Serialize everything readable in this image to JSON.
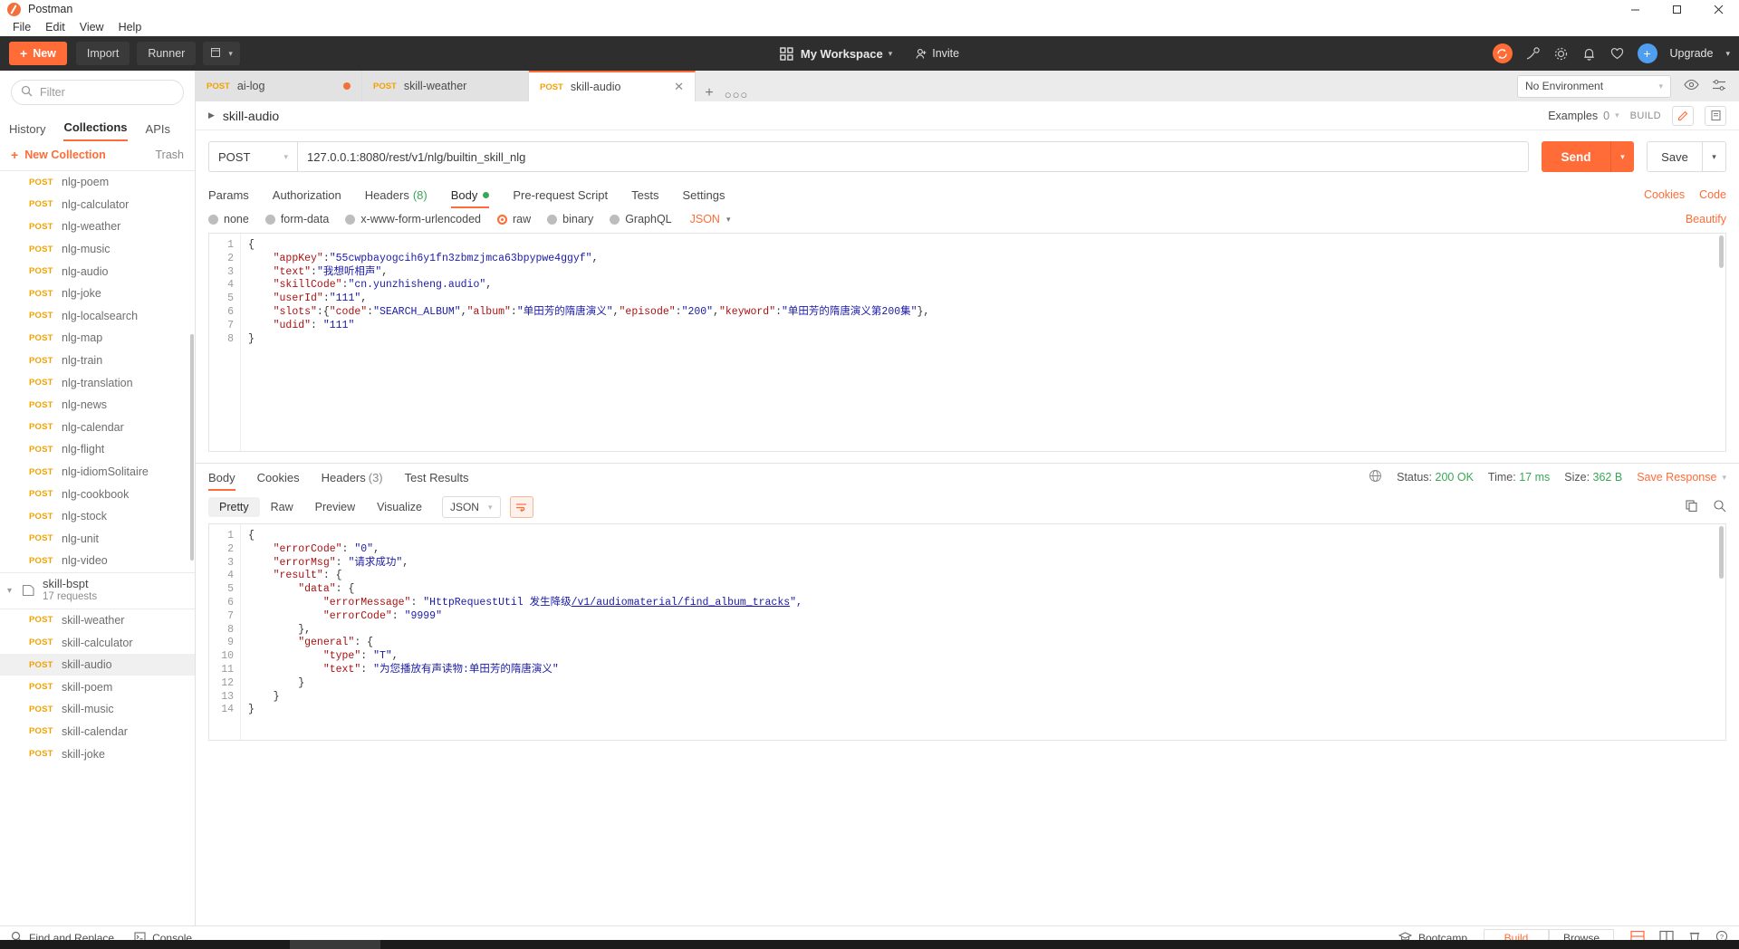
{
  "window": {
    "app_title": "Postman",
    "minimize": "–",
    "maximize": "❐",
    "close": "✕"
  },
  "menu": [
    "File",
    "Edit",
    "View",
    "Help"
  ],
  "toolbar": {
    "new_label": "New",
    "import_label": "Import",
    "runner_label": "Runner",
    "workspace_label": "My Workspace",
    "invite_label": "Invite",
    "upgrade_label": "Upgrade",
    "accent": "#ff6c37"
  },
  "sidebar": {
    "filter_placeholder": "Filter",
    "tabs": [
      "History",
      "Collections",
      "APIs"
    ],
    "active_tab": "Collections",
    "new_collection": "New Collection",
    "trash": "Trash",
    "requests_top": [
      {
        "method": "POST",
        "name": "nlg-poem"
      },
      {
        "method": "POST",
        "name": "nlg-calculator"
      },
      {
        "method": "POST",
        "name": "nlg-weather"
      },
      {
        "method": "POST",
        "name": "nlg-music"
      },
      {
        "method": "POST",
        "name": "nlg-audio"
      },
      {
        "method": "POST",
        "name": "nlg-joke"
      },
      {
        "method": "POST",
        "name": "nlg-localsearch"
      },
      {
        "method": "POST",
        "name": "nlg-map"
      },
      {
        "method": "POST",
        "name": "nlg-train"
      },
      {
        "method": "POST",
        "name": "nlg-translation"
      },
      {
        "method": "POST",
        "name": "nlg-news"
      },
      {
        "method": "POST",
        "name": "nlg-calendar"
      },
      {
        "method": "POST",
        "name": "nlg-flight"
      },
      {
        "method": "POST",
        "name": "nlg-idiomSolitaire"
      },
      {
        "method": "POST",
        "name": "nlg-cookbook"
      },
      {
        "method": "POST",
        "name": "nlg-stock"
      },
      {
        "method": "POST",
        "name": "nlg-unit"
      },
      {
        "method": "POST",
        "name": "nlg-video"
      }
    ],
    "folder": {
      "name": "skill-bspt",
      "count": "17 requests"
    },
    "requests_bottom": [
      {
        "method": "POST",
        "name": "skill-weather",
        "selected": false
      },
      {
        "method": "POST",
        "name": "skill-calculator",
        "selected": false
      },
      {
        "method": "POST",
        "name": "skill-audio",
        "selected": true
      },
      {
        "method": "POST",
        "name": "skill-poem",
        "selected": false
      },
      {
        "method": "POST",
        "name": "skill-music",
        "selected": false
      },
      {
        "method": "POST",
        "name": "skill-calendar",
        "selected": false
      },
      {
        "method": "POST",
        "name": "skill-joke",
        "selected": false
      }
    ]
  },
  "tabs": {
    "items": [
      {
        "method": "POST",
        "name": "ai-log",
        "unsaved": true,
        "active": false
      },
      {
        "method": "POST",
        "name": "skill-weather",
        "unsaved": false,
        "active": false
      },
      {
        "method": "POST",
        "name": "skill-audio",
        "unsaved": false,
        "active": true
      }
    ],
    "add": "+",
    "more": "○○○",
    "environment": "No Environment"
  },
  "request": {
    "name": "skill-audio",
    "examples_label": "Examples",
    "examples_count": "0",
    "build_label": "BUILD",
    "method": "POST",
    "url": "127.0.0.1:8080/rest/v1/nlg/builtin_skill_nlg",
    "send_label": "Send",
    "save_label": "Save",
    "tabs": [
      {
        "label": "Params",
        "badge": "",
        "active": false
      },
      {
        "label": "Authorization",
        "badge": "",
        "active": false
      },
      {
        "label": "Headers",
        "badge": "(8)",
        "active": false
      },
      {
        "label": "Body",
        "badge": "",
        "active": true,
        "dot": true
      },
      {
        "label": "Pre-request Script",
        "badge": "",
        "active": false
      },
      {
        "label": "Tests",
        "badge": "",
        "active": false
      },
      {
        "label": "Settings",
        "badge": "",
        "active": false
      }
    ],
    "cookies_link": "Cookies",
    "code_link": "Code",
    "body_types": [
      {
        "label": "none",
        "on": false
      },
      {
        "label": "form-data",
        "on": false
      },
      {
        "label": "x-www-form-urlencoded",
        "on": false
      },
      {
        "label": "raw",
        "on": true
      },
      {
        "label": "binary",
        "on": false
      },
      {
        "label": "GraphQL",
        "on": false
      }
    ],
    "format": "JSON",
    "beautify": "Beautify",
    "body_lines": [
      [
        {
          "t": "{",
          "c": "p"
        }
      ],
      [
        {
          "t": "    ",
          "c": "p"
        },
        {
          "t": "\"appKey\"",
          "c": "k"
        },
        {
          "t": ":",
          "c": "p"
        },
        {
          "t": "\"55cwpbayogcih6y1fn3zbmzjmca63bpypwe4ggyf\"",
          "c": "s"
        },
        {
          "t": ",",
          "c": "p"
        }
      ],
      [
        {
          "t": "    ",
          "c": "p"
        },
        {
          "t": "\"text\"",
          "c": "k"
        },
        {
          "t": ":",
          "c": "p"
        },
        {
          "t": "\"我想听相声\"",
          "c": "s"
        },
        {
          "t": ",",
          "c": "p"
        }
      ],
      [
        {
          "t": "    ",
          "c": "p"
        },
        {
          "t": "\"skillCode\"",
          "c": "k"
        },
        {
          "t": ":",
          "c": "p"
        },
        {
          "t": "\"cn.yunzhisheng.audio\"",
          "c": "s"
        },
        {
          "t": ",",
          "c": "p"
        }
      ],
      [
        {
          "t": "    ",
          "c": "p"
        },
        {
          "t": "\"userId\"",
          "c": "k"
        },
        {
          "t": ":",
          "c": "p"
        },
        {
          "t": "\"111\"",
          "c": "s"
        },
        {
          "t": ",",
          "c": "p"
        }
      ],
      [
        {
          "t": "    ",
          "c": "p"
        },
        {
          "t": "\"slots\"",
          "c": "k"
        },
        {
          "t": ":{",
          "c": "p"
        },
        {
          "t": "\"code\"",
          "c": "k"
        },
        {
          "t": ":",
          "c": "p"
        },
        {
          "t": "\"SEARCH_ALBUM\"",
          "c": "s"
        },
        {
          "t": ",",
          "c": "p"
        },
        {
          "t": "\"album\"",
          "c": "k"
        },
        {
          "t": ":",
          "c": "p"
        },
        {
          "t": "\"单田芳的隋唐演义\"",
          "c": "s"
        },
        {
          "t": ",",
          "c": "p"
        },
        {
          "t": "\"episode\"",
          "c": "k"
        },
        {
          "t": ":",
          "c": "p"
        },
        {
          "t": "\"200\"",
          "c": "s"
        },
        {
          "t": ",",
          "c": "p"
        },
        {
          "t": "\"keyword\"",
          "c": "k"
        },
        {
          "t": ":",
          "c": "p"
        },
        {
          "t": "\"单田芳的隋唐演义第200集\"",
          "c": "s"
        },
        {
          "t": "},",
          "c": "p"
        }
      ],
      [
        {
          "t": "    ",
          "c": "p"
        },
        {
          "t": "\"udid\"",
          "c": "k"
        },
        {
          "t": ": ",
          "c": "p"
        },
        {
          "t": "\"111\"",
          "c": "s"
        }
      ],
      [
        {
          "t": "}",
          "c": "p"
        }
      ]
    ]
  },
  "response": {
    "tabs": [
      {
        "label": "Body",
        "badge": "",
        "active": true
      },
      {
        "label": "Cookies",
        "badge": "",
        "active": false
      },
      {
        "label": "Headers",
        "badge": "(3)",
        "active": false
      },
      {
        "label": "Test Results",
        "badge": "",
        "active": false
      }
    ],
    "status_label": "Status:",
    "status_value": "200 OK",
    "time_label": "Time:",
    "time_value": "17 ms",
    "size_label": "Size:",
    "size_value": "362 B",
    "save_response": "Save Response",
    "view_tabs": [
      "Pretty",
      "Raw",
      "Preview",
      "Visualize"
    ],
    "view_active": "Pretty",
    "format": "JSON",
    "body_lines": [
      [
        {
          "t": "{",
          "c": "p"
        }
      ],
      [
        {
          "t": "    ",
          "c": "p"
        },
        {
          "t": "\"errorCode\"",
          "c": "k"
        },
        {
          "t": ": ",
          "c": "p"
        },
        {
          "t": "\"0\"",
          "c": "s"
        },
        {
          "t": ",",
          "c": "p"
        }
      ],
      [
        {
          "t": "    ",
          "c": "p"
        },
        {
          "t": "\"errorMsg\"",
          "c": "k"
        },
        {
          "t": ": ",
          "c": "p"
        },
        {
          "t": "\"请求成功\"",
          "c": "s"
        },
        {
          "t": ",",
          "c": "p"
        }
      ],
      [
        {
          "t": "    ",
          "c": "p"
        },
        {
          "t": "\"result\"",
          "c": "k"
        },
        {
          "t": ": {",
          "c": "p"
        }
      ],
      [
        {
          "t": "        ",
          "c": "p"
        },
        {
          "t": "\"data\"",
          "c": "k"
        },
        {
          "t": ": {",
          "c": "p"
        }
      ],
      [
        {
          "t": "            ",
          "c": "p"
        },
        {
          "t": "\"errorMessage\"",
          "c": "k"
        },
        {
          "t": ": ",
          "c": "p"
        },
        {
          "t": "\"HttpRequestUtil 发生降级",
          "c": "s"
        },
        {
          "t": "/v1/audiomaterial/find_album_tracks",
          "c": "u"
        },
        {
          "t": "\",",
          "c": "s"
        }
      ],
      [
        {
          "t": "            ",
          "c": "p"
        },
        {
          "t": "\"errorCode\"",
          "c": "k"
        },
        {
          "t": ": ",
          "c": "p"
        },
        {
          "t": "\"9999\"",
          "c": "s"
        }
      ],
      [
        {
          "t": "        },",
          "c": "p"
        }
      ],
      [
        {
          "t": "        ",
          "c": "p"
        },
        {
          "t": "\"general\"",
          "c": "k"
        },
        {
          "t": ": {",
          "c": "p"
        }
      ],
      [
        {
          "t": "            ",
          "c": "p"
        },
        {
          "t": "\"type\"",
          "c": "k"
        },
        {
          "t": ": ",
          "c": "p"
        },
        {
          "t": "\"T\"",
          "c": "s"
        },
        {
          "t": ",",
          "c": "p"
        }
      ],
      [
        {
          "t": "            ",
          "c": "p"
        },
        {
          "t": "\"text\"",
          "c": "k"
        },
        {
          "t": ": ",
          "c": "p"
        },
        {
          "t": "\"为您播放有声读物:单田芳的隋唐演义\"",
          "c": "s"
        }
      ],
      [
        {
          "t": "        }",
          "c": "p"
        }
      ],
      [
        {
          "t": "    }",
          "c": "p"
        }
      ],
      [
        {
          "t": "}",
          "c": "p"
        }
      ]
    ]
  },
  "footer": {
    "find_replace": "Find and Replace",
    "console": "Console",
    "bootcamp": "Bootcamp",
    "build": "Build",
    "browse": "Browse"
  }
}
